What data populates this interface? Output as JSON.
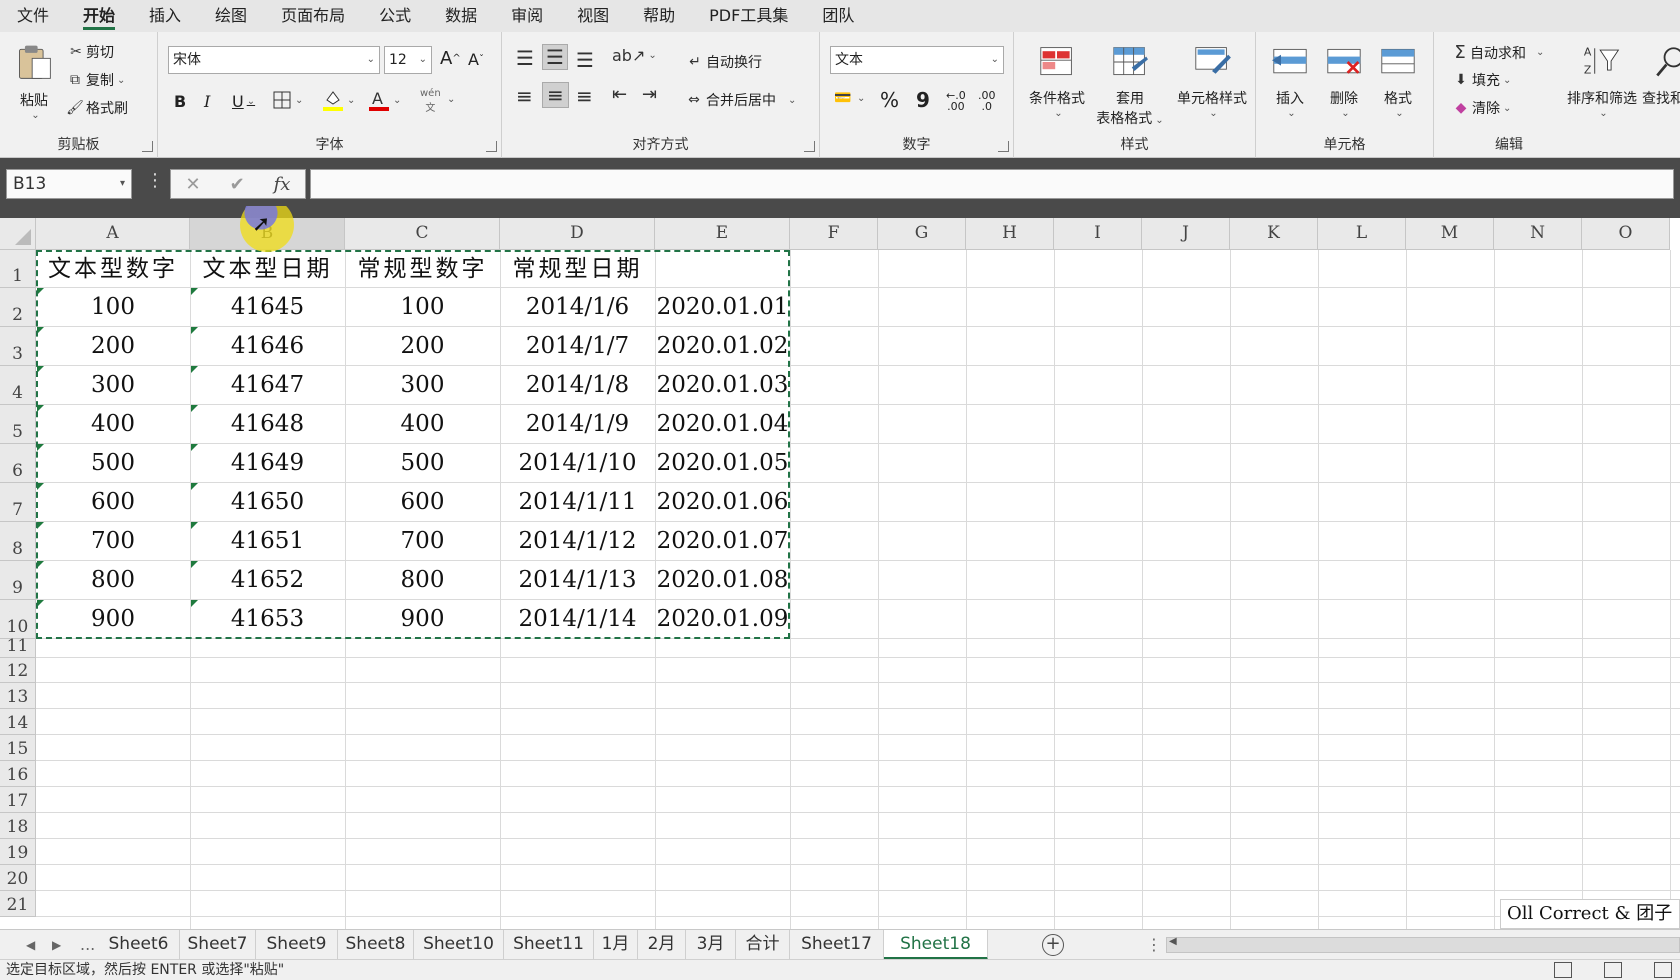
{
  "menu": [
    "文件",
    "开始",
    "插入",
    "绘图",
    "页面布局",
    "公式",
    "数据",
    "审阅",
    "视图",
    "帮助",
    "PDF工具集",
    "团队"
  ],
  "menu_active": "开始",
  "ribbon": {
    "clipboard": {
      "paste": "粘贴",
      "cut": "剪切",
      "copy": "复制",
      "format_painter": "格式刷",
      "label": "剪贴板"
    },
    "font": {
      "name": "宋体",
      "size": "12",
      "bold": "B",
      "italic": "I",
      "underline": "U",
      "grow": "A",
      "shrink": "A",
      "wen": "wén",
      "wen_sub": "文",
      "label": "字体"
    },
    "alignment": {
      "wrap": "自动换行",
      "merge": "合并后居中",
      "label": "对齐方式"
    },
    "number": {
      "format": "文本",
      "percent": "%",
      "comma": "9",
      "inc": ".00",
      "dec": ".0",
      "label": "数字"
    },
    "styles": {
      "conditional": "条件格式",
      "table_line1": "套用",
      "table_line2": "表格格式",
      "cell_styles": "单元格样式",
      "label": "样式"
    },
    "cells": {
      "insert": "插入",
      "delete": "删除",
      "format": "格式",
      "label": "单元格"
    },
    "editing": {
      "autosum": "自动求和",
      "fill": "填充",
      "clear": "清除",
      "sort_filter": "排序和筛选",
      "find": "查找和",
      "label": "编辑"
    }
  },
  "formula_bar": {
    "name_box": "B13",
    "cancel": "✕",
    "enter": "✔",
    "fx": "fx",
    "content": ""
  },
  "columns": [
    "A",
    "B",
    "C",
    "D",
    "E",
    "F",
    "G",
    "H",
    "I",
    "J",
    "K",
    "L",
    "M",
    "N",
    "O"
  ],
  "rows": [
    "1",
    "2",
    "3",
    "4",
    "5",
    "6",
    "7",
    "8",
    "9",
    "10",
    "11",
    "12",
    "13",
    "14",
    "15",
    "16",
    "17",
    "18",
    "19",
    "20",
    "21"
  ],
  "table": {
    "headers": [
      "文本型数字",
      "文本型日期",
      "常规型数字",
      "常规型日期",
      ""
    ],
    "data": [
      [
        "100",
        "41645",
        "100",
        "2014/1/6",
        "2020.01.01"
      ],
      [
        "200",
        "41646",
        "200",
        "2014/1/7",
        "2020.01.02"
      ],
      [
        "300",
        "41647",
        "300",
        "2014/1/8",
        "2020.01.03"
      ],
      [
        "400",
        "41648",
        "400",
        "2014/1/9",
        "2020.01.04"
      ],
      [
        "500",
        "41649",
        "500",
        "2014/1/10",
        "2020.01.05"
      ],
      [
        "600",
        "41650",
        "600",
        "2014/1/11",
        "2020.01.06"
      ],
      [
        "700",
        "41651",
        "700",
        "2014/1/12",
        "2020.01.07"
      ],
      [
        "800",
        "41652",
        "800",
        "2014/1/13",
        "2020.01.08"
      ],
      [
        "900",
        "41653",
        "900",
        "2014/1/14",
        "2020.01.09"
      ]
    ]
  },
  "watermark": "Oll Correct & 团子",
  "sheet_tabs": {
    "ellipsis": "...",
    "tabs": [
      "Sheet6",
      "Sheet7",
      "Sheet9",
      "Sheet8",
      "Sheet10",
      "Sheet11",
      "1月",
      "2月",
      "3月",
      "合计",
      "Sheet17",
      "Sheet18"
    ],
    "active": "Sheet18",
    "add": "+"
  },
  "status": "选定目标区域，然后按 ENTER 或选择\"粘贴\"",
  "colors": {
    "accent": "#217346",
    "error_triangle": "#1f7a3e",
    "dark_band": "#4a4a4a"
  }
}
